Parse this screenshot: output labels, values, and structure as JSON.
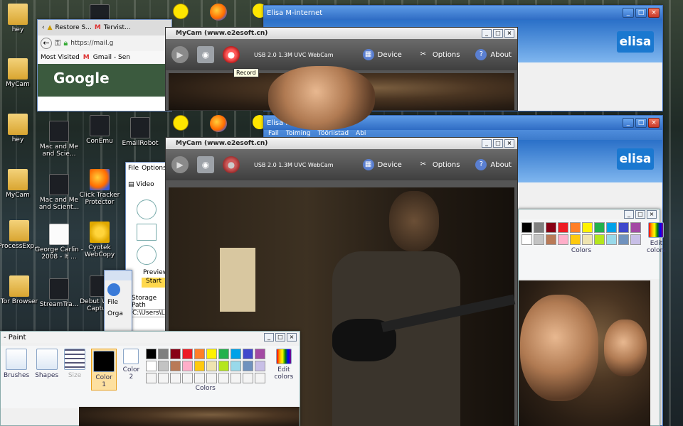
{
  "desktop": {
    "icons": [
      {
        "label": "hey",
        "kind": "folder"
      },
      {
        "label": "MyCam",
        "kind": "folder"
      },
      {
        "label": "ProcessExp...",
        "kind": "folder"
      },
      {
        "label": "Tor Browser",
        "kind": "folder"
      },
      {
        "label": "Mac and Me and Scie...",
        "kind": "dark"
      },
      {
        "label": "Mac and Me and Scient...",
        "kind": "dark"
      },
      {
        "label": "George Carlin - 2008 - It ...",
        "kind": "page"
      },
      {
        "label": "StreamTra...",
        "kind": "dark"
      },
      {
        "label": "ConEmu",
        "kind": "dark"
      },
      {
        "label": "EmailRobot",
        "kind": "dark"
      },
      {
        "label": "Click Tracker Protector",
        "kind": "dark"
      },
      {
        "label": "Cyotek WebCopy",
        "kind": "cyan"
      },
      {
        "label": "Debut Video Capture",
        "kind": "dark"
      }
    ]
  },
  "browser": {
    "tabs": [
      "Restore S...",
      "Tervist..."
    ],
    "url": "https://mail.g",
    "bookmarks": [
      "Most Visited",
      "Gmail - Sen"
    ],
    "logo": "Google"
  },
  "elisa": {
    "title": "Elisa M-internet",
    "menu": [
      "Fail",
      "Toiming",
      "Tööriistad",
      "Abi"
    ],
    "logo": "elisa"
  },
  "mycam": {
    "title": "MyCam (www.e2esoft.cn)",
    "device_name": "USB 2.0 1.3M UVC WebCam",
    "menu": [
      "Device",
      "Options",
      "About"
    ],
    "tooltip": "Record"
  },
  "debut": {
    "menu": [
      "File",
      "Options"
    ],
    "video_label": "Video",
    "preview_label": "Preview",
    "start_label": "Start",
    "storage_label": "Storage Path",
    "storage_path": "C:\\Users\\Lo"
  },
  "paint": {
    "title": "- Paint",
    "tools": [
      "Brushes",
      "Shapes",
      "Size"
    ],
    "color1": "Color 1",
    "color2": "Color 2",
    "edit_colors": "Edit colors",
    "colors_group": "Colors",
    "palette": [
      "#000000",
      "#7f7f7f",
      "#880015",
      "#ed1c24",
      "#ff7f27",
      "#fff200",
      "#22b14c",
      "#00a2e8",
      "#3f48cc",
      "#a349a4",
      "#ffffff",
      "#c3c3c3",
      "#b97a57",
      "#ffaec9",
      "#ffc90e",
      "#efe4b0",
      "#b5e61d",
      "#99d9ea",
      "#7092be",
      "#c8bfe7",
      "#f4f4f4",
      "#f4f4f4",
      "#f4f4f4",
      "#f4f4f4",
      "#f4f4f4",
      "#f4f4f4",
      "#f4f4f4",
      "#f4f4f4",
      "#f4f4f4",
      "#f4f4f4"
    ]
  },
  "small_window": {
    "menu": "File",
    "org": "Orga"
  }
}
